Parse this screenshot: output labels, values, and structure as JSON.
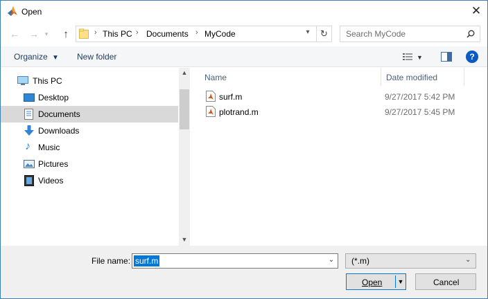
{
  "window": {
    "title": "Open"
  },
  "address": {
    "crumbs": [
      "This PC",
      "Documents",
      "MyCode"
    ]
  },
  "search": {
    "placeholder": "Search MyCode"
  },
  "toolbar": {
    "organize_label": "Organize",
    "new_folder_label": "New folder"
  },
  "sidebar": {
    "items": [
      {
        "label": "This PC",
        "icon": "computer-icon"
      },
      {
        "label": "Desktop",
        "icon": "desktop-icon"
      },
      {
        "label": "Documents",
        "icon": "documents-icon",
        "selected": true
      },
      {
        "label": "Downloads",
        "icon": "downloads-icon"
      },
      {
        "label": "Music",
        "icon": "music-icon"
      },
      {
        "label": "Pictures",
        "icon": "pictures-icon"
      },
      {
        "label": "Videos",
        "icon": "videos-icon"
      }
    ]
  },
  "files": {
    "columns": [
      "Name",
      "Date modified"
    ],
    "rows": [
      {
        "name": "surf.m",
        "date": "9/27/2017 5:42 PM"
      },
      {
        "name": "plotrand.m",
        "date": "9/27/2017 5:45 PM"
      }
    ]
  },
  "footer": {
    "file_name_label": "File name:",
    "file_name_value": "surf.m",
    "filter_value": "(*.m)",
    "open_label": "Open",
    "cancel_label": "Cancel"
  },
  "colors": {
    "accent": "#0078d7",
    "selection": "#d9d9d9"
  }
}
